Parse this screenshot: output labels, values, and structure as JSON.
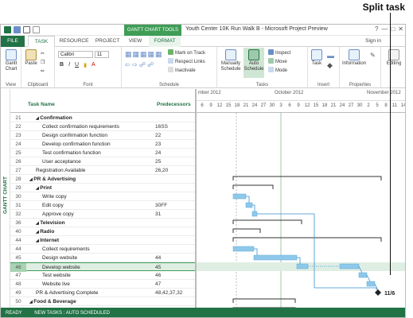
{
  "callout": {
    "label": "Split task"
  },
  "window": {
    "title": "Youth Center 10K Run Walk B - Microsoft Project Preview",
    "context_tools": "GANTT CHART TOOLS",
    "sign_in": "Sign in"
  },
  "tabs": [
    "FILE",
    "TASK",
    "RESOURCE",
    "PROJECT",
    "VIEW",
    "FORMAT"
  ],
  "ribbon": {
    "view": {
      "btn": "Gantt Chart",
      "label": "View"
    },
    "clipboard": {
      "paste": "Paste",
      "label": "Clipboard"
    },
    "font": {
      "name": "Calibri",
      "size": "11",
      "label": "Font",
      "bold": "B",
      "italic": "I",
      "underline": "U"
    },
    "schedule": {
      "mark": "Mark on Track",
      "respect": "Respect Links",
      "inactivate": "Inactivate",
      "label": "Schedule"
    },
    "tasks": {
      "manual": "Manually Schedule",
      "auto": "Auto Schedule",
      "inspect": "Inspect",
      "move": "Move",
      "mode": "Mode",
      "label": "Tasks"
    },
    "insert": {
      "task": "Task",
      "label": "Insert"
    },
    "properties": {
      "info": "Information",
      "label": "Properties"
    },
    "editing": {
      "label": "Editing"
    }
  },
  "sidebar_label": "GANTT CHART",
  "grid": {
    "col_name": "Task Name",
    "col_pred": "Predecessors",
    "rows": [
      {
        "id": "21",
        "name": "Confirmation",
        "pred": "",
        "indent": 2,
        "summary": true
      },
      {
        "id": "22",
        "name": "Collect confirmation requirements",
        "pred": "16SS",
        "indent": 3,
        "summary": false
      },
      {
        "id": "23",
        "name": "Design confirmation function",
        "pred": "22",
        "indent": 3,
        "summary": false
      },
      {
        "id": "24",
        "name": "Develop confirmation function",
        "pred": "23",
        "indent": 3,
        "summary": false
      },
      {
        "id": "25",
        "name": "Test confirmation function",
        "pred": "24",
        "indent": 3,
        "summary": false
      },
      {
        "id": "26",
        "name": "User acceptance",
        "pred": "25",
        "indent": 3,
        "summary": false
      },
      {
        "id": "27",
        "name": "Registration Available",
        "pred": "26,20",
        "indent": 2,
        "summary": false
      },
      {
        "id": "28",
        "name": "PR & Advertising",
        "pred": "",
        "indent": 1,
        "summary": true
      },
      {
        "id": "29",
        "name": "Print",
        "pred": "",
        "indent": 2,
        "summary": true
      },
      {
        "id": "30",
        "name": "Write copy",
        "pred": "",
        "indent": 3,
        "summary": false
      },
      {
        "id": "31",
        "name": "Edit copy",
        "pred": "30FF",
        "indent": 3,
        "summary": false
      },
      {
        "id": "32",
        "name": "Approve copy",
        "pred": "31",
        "indent": 3,
        "summary": false
      },
      {
        "id": "36",
        "name": "Television",
        "pred": "",
        "indent": 2,
        "summary": true
      },
      {
        "id": "40",
        "name": "Radio",
        "pred": "",
        "indent": 2,
        "summary": true
      },
      {
        "id": "44",
        "name": "Internet",
        "pred": "",
        "indent": 2,
        "summary": true
      },
      {
        "id": "44",
        "name": "Collect requirements",
        "pred": "",
        "indent": 3,
        "summary": false
      },
      {
        "id": "45",
        "name": "Design website",
        "pred": "44",
        "indent": 3,
        "summary": false
      },
      {
        "id": "46",
        "name": "Develop website",
        "pred": "45",
        "indent": 3,
        "summary": false,
        "selected": true
      },
      {
        "id": "47",
        "name": "Test website",
        "pred": "46",
        "indent": 3,
        "summary": false
      },
      {
        "id": "48",
        "name": "Website live",
        "pred": "47",
        "indent": 3,
        "summary": false
      },
      {
        "id": "49",
        "name": "PR & Advertising Complete",
        "pred": "48,42,37,32",
        "indent": 2,
        "summary": false
      },
      {
        "id": "50",
        "name": "Food & Beverage",
        "pred": "",
        "indent": 1,
        "summary": true
      },
      {
        "id": "51",
        "name": "Finish line food",
        "pred": "",
        "indent": 2,
        "summary": true
      }
    ]
  },
  "timeline": {
    "months": [
      "mber 2012",
      "October 2012",
      "November 2012"
    ],
    "days": [
      "6",
      "9",
      "12",
      "15",
      "18",
      "21",
      "24",
      "27",
      "30",
      "3",
      "6",
      "9",
      "12",
      "15",
      "18",
      "21",
      "24",
      "27",
      "30",
      "2",
      "5",
      "8",
      "11",
      "14"
    ]
  },
  "milestone_label": "11/6",
  "status": {
    "ready": "READY",
    "mode": "NEW TASKS : AUTO SCHEDULED"
  },
  "colors": {
    "accent": "#217346",
    "bar": "#8ec8ea",
    "bar_dark": "#5aa7d6",
    "summary": "#333333",
    "selected": "#dfeee3"
  }
}
